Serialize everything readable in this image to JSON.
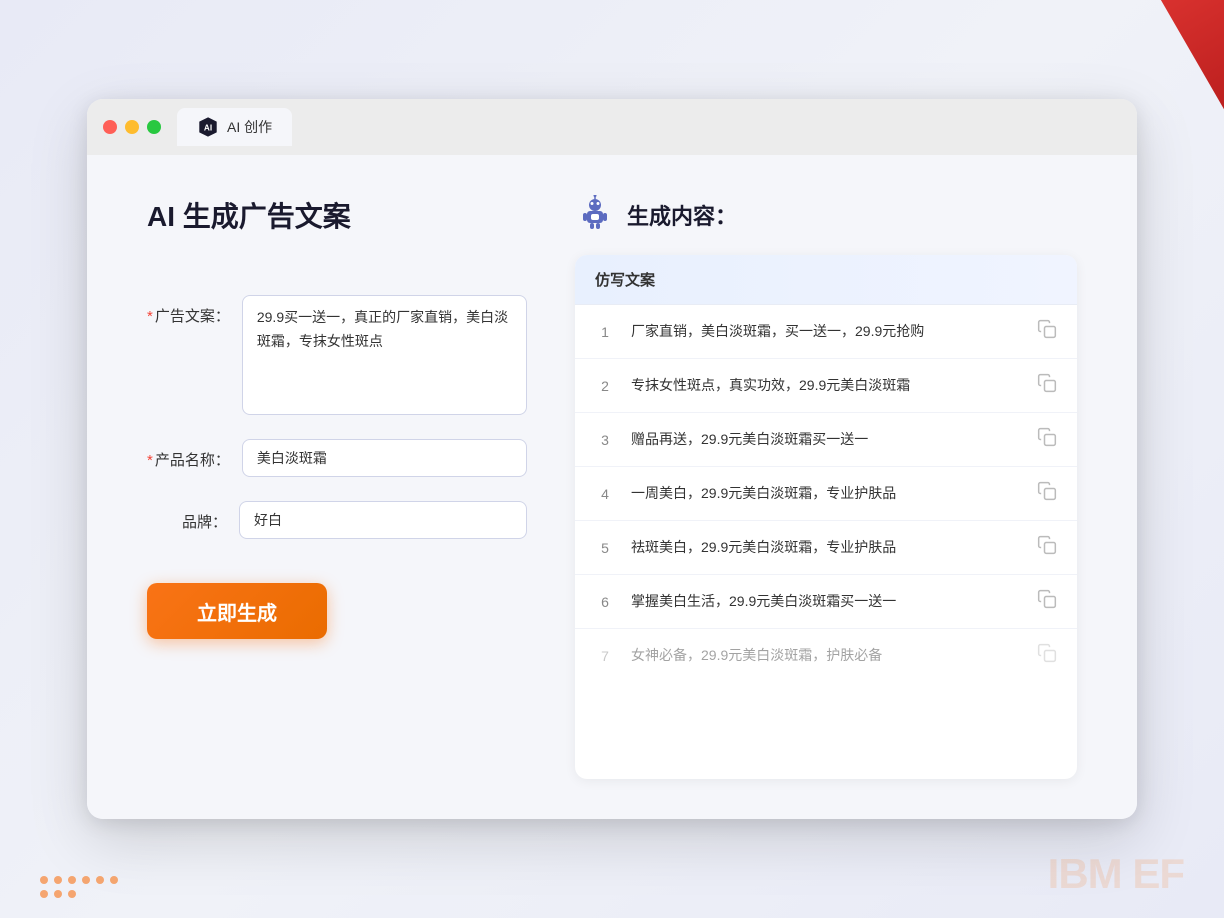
{
  "browser": {
    "tab_label": "AI 创作"
  },
  "app": {
    "title": "AI 生成广告文案"
  },
  "form": {
    "ad_copy_label": "广告文案：",
    "ad_copy_required": "*",
    "ad_copy_value": "29.9买一送一，真正的厂家直销，美白淡斑霜，专抹女性斑点",
    "product_name_label": "产品名称：",
    "product_name_required": "*",
    "product_name_value": "美白淡斑霜",
    "brand_label": "品牌：",
    "brand_value": "好白",
    "generate_button": "立即生成"
  },
  "results": {
    "section_title": "生成内容：",
    "column_header": "仿写文案",
    "items": [
      {
        "id": 1,
        "text": "厂家直销，美白淡斑霜，买一送一，29.9元抢购"
      },
      {
        "id": 2,
        "text": "专抹女性斑点，真实功效，29.9元美白淡斑霜"
      },
      {
        "id": 3,
        "text": "赠品再送，29.9元美白淡斑霜买一送一"
      },
      {
        "id": 4,
        "text": "一周美白，29.9元美白淡斑霜，专业护肤品"
      },
      {
        "id": 5,
        "text": "祛斑美白，29.9元美白淡斑霜，专业护肤品"
      },
      {
        "id": 6,
        "text": "掌握美白生活，29.9元美白淡斑霜买一送一"
      },
      {
        "id": 7,
        "text": "女神必备，29.9元美白淡斑霜，护肤必备",
        "faded": true
      }
    ]
  },
  "decorations": {
    "ibm_ef_text": "IBM EF"
  },
  "colors": {
    "orange": "#f97316",
    "brand": "#5c6bc0"
  }
}
